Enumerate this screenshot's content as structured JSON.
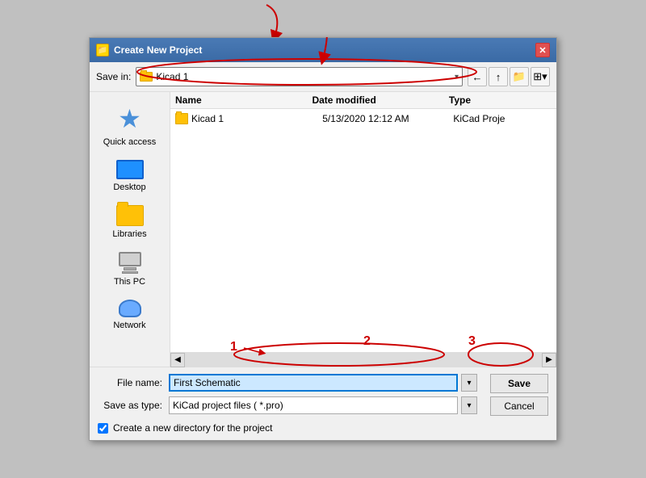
{
  "dialog": {
    "title": "Create New Project",
    "title_icon": "📁",
    "close_label": "✕"
  },
  "toolbar": {
    "save_in_label": "Save in:",
    "path_value": "Kicad 1",
    "back_icon": "⬅",
    "up_icon": "⬆",
    "new_folder_icon": "📁",
    "view_icon": "⊞"
  },
  "sidebar": {
    "items": [
      {
        "id": "quick-access",
        "label": "Quick access"
      },
      {
        "id": "desktop",
        "label": "Desktop"
      },
      {
        "id": "libraries",
        "label": "Libraries"
      },
      {
        "id": "this-pc",
        "label": "This PC"
      },
      {
        "id": "network",
        "label": "Network"
      }
    ]
  },
  "file_list": {
    "columns": [
      "Name",
      "Date modified",
      "Type"
    ],
    "rows": [
      {
        "name": "Kicad 1",
        "date": "5/13/2020 12:12 AM",
        "type": "KiCad Proje"
      }
    ]
  },
  "form": {
    "file_name_label": "File name:",
    "file_name_value": "First Schematic",
    "file_name_placeholder": "First Schematic",
    "save_type_label": "Save as type:",
    "save_type_value": "KiCad project files ( *.pro)",
    "save_button": "Save",
    "cancel_button": "Cancel",
    "checkbox_label": "Create a new directory for the project",
    "checkbox_checked": true
  }
}
